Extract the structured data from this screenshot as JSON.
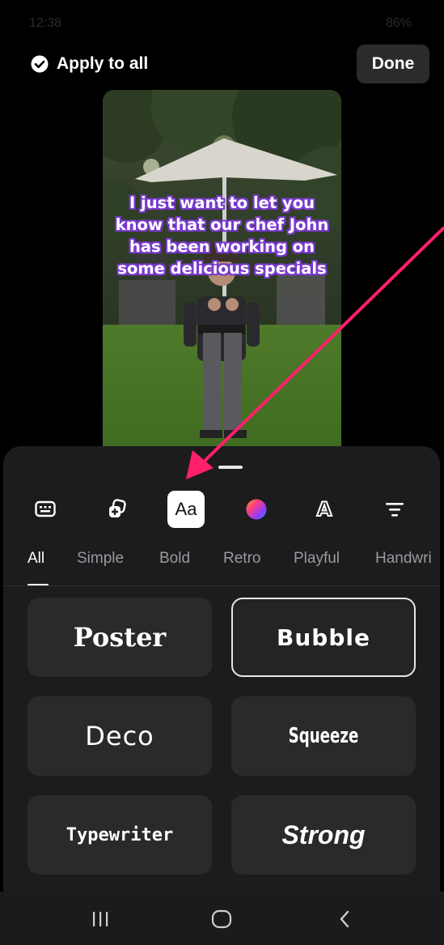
{
  "status_bar": {
    "time": "12:38",
    "battery": "86%"
  },
  "top_bar": {
    "apply_to_all_label": "Apply to all",
    "done_label": "Done"
  },
  "preview": {
    "caption": "I just want to let you know that our chef John has been working on some delicious specials"
  },
  "toolbar": {
    "items": [
      {
        "name": "keyboard-icon"
      },
      {
        "name": "text-effects-icon"
      },
      {
        "name": "font-icon",
        "label": "Aa",
        "active": true
      },
      {
        "name": "color-icon"
      },
      {
        "name": "text-style-icon",
        "label": "A"
      },
      {
        "name": "align-icon"
      }
    ]
  },
  "tabs": [
    {
      "label": "All",
      "active": true
    },
    {
      "label": "Simple"
    },
    {
      "label": "Bold"
    },
    {
      "label": "Retro"
    },
    {
      "label": "Playful"
    },
    {
      "label": "Handwri"
    }
  ],
  "fonts": [
    {
      "label": "Poster"
    },
    {
      "label": "Bubble",
      "selected": true
    },
    {
      "label": "Deco"
    },
    {
      "label": "Squeeze"
    },
    {
      "label": "Typewriter"
    },
    {
      "label": "Strong"
    }
  ],
  "colors": {
    "sheet_bg": "#1c1c1e",
    "card_bg": "#2a2a2c",
    "annotation_arrow": "#ff1f6b",
    "caption_outline": "#7b3ccf"
  }
}
